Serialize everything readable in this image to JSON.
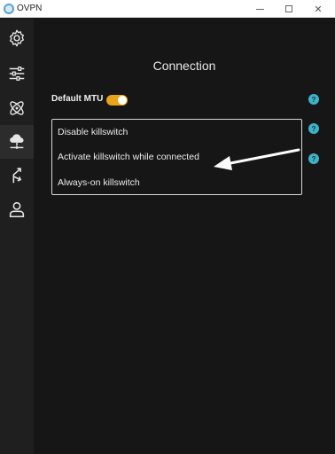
{
  "window": {
    "title": "OVPN",
    "controls": {
      "minimize": "minimize",
      "maximize": "maximize",
      "close": "✕"
    }
  },
  "sidebar": {
    "items": [
      {
        "icon": "gear-icon",
        "active": false
      },
      {
        "icon": "sliders-icon",
        "active": false
      },
      {
        "icon": "atom-icon",
        "active": false
      },
      {
        "icon": "network-tree-icon",
        "active": true
      },
      {
        "icon": "split-route-icon",
        "active": false
      },
      {
        "icon": "user-icon",
        "active": false
      }
    ]
  },
  "main": {
    "title": "Connection",
    "default_mtu": {
      "label": "Default MTU",
      "enabled": true
    },
    "help_label": "?",
    "killswitch": {
      "options": [
        "Disable killswitch",
        "Activate killswitch while connected",
        "Always-on killswitch"
      ]
    },
    "annotation": "white-arrow-pointer"
  },
  "colors": {
    "toggle_on": "#e8a317",
    "help_badge": "#3db3c9",
    "background": "#161616",
    "sidebar": "#1f1f1f"
  }
}
